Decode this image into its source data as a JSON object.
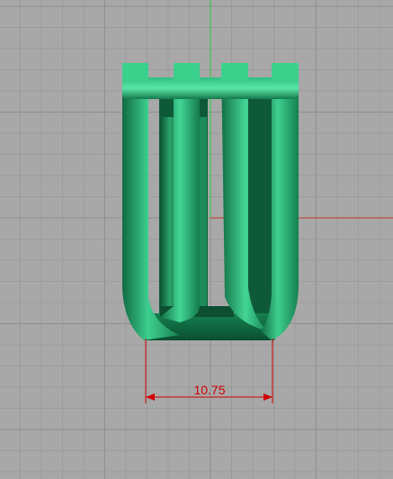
{
  "viewport": {
    "background": "#a8a8a8",
    "grid_minor_color": "#9b9b9b",
    "grid_major_color": "#8e8e8e",
    "x_axis_color": "#c0392b",
    "y_axis_color": "#2ecc40",
    "object_color": "#1fa56a"
  },
  "model": {
    "name": "ring-model-icon"
  },
  "dimension": {
    "value_text": "10.75",
    "color": "#d10000"
  }
}
